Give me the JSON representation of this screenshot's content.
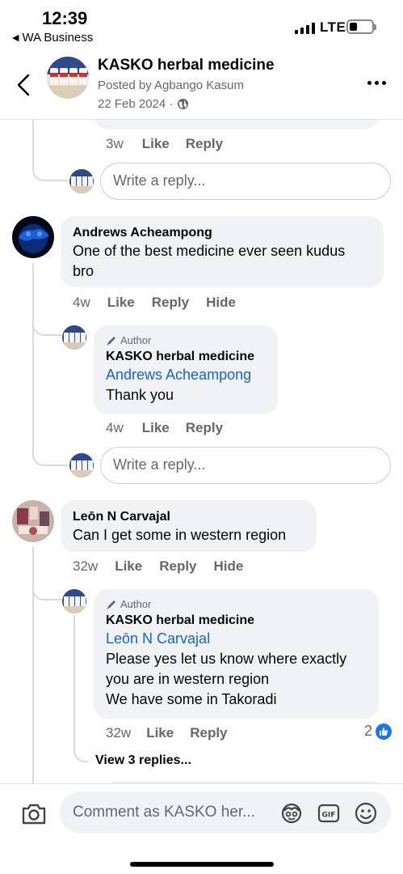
{
  "status": {
    "time": "12:39",
    "back_app": "WA Business",
    "network": "LTE"
  },
  "header": {
    "title": "KASKO herbal medicine",
    "posted_by": "Posted by Agbango Kasum",
    "date": "22 Feb 2024 ·"
  },
  "thread0": {
    "time": "3w",
    "like": "Like",
    "reply": "Reply",
    "reply_placeholder": "Write a reply..."
  },
  "comment1": {
    "name": "Andrews Acheampong",
    "text_line1": "One of the best medicine ever seen kudus",
    "text_line2": "bro",
    "time": "4w",
    "like": "Like",
    "reply": "Reply",
    "hide": "Hide",
    "author_reply": {
      "tag": "Author",
      "name": "KASKO herbal medicine",
      "mention": "Andrews Acheampong",
      "text": "Thank you",
      "time": "4w",
      "like": "Like",
      "reply": "Reply"
    },
    "reply_placeholder": "Write a reply..."
  },
  "comment2": {
    "name": "Leōn N Carvajal",
    "text": "Can I get some in western region",
    "time": "32w",
    "like": "Like",
    "reply": "Reply",
    "hide": "Hide",
    "author_reply": {
      "tag": "Author",
      "name": "KASKO herbal medicine",
      "mention": "Leōn N Carvajal",
      "line1": "Please yes let us know where exactly",
      "line2": "you are in western region",
      "line3": "We have some in Takoradi",
      "time": "32w",
      "like": "Like",
      "reply": "Reply",
      "reaction_count": "2"
    },
    "view_replies": "View 3 replies..."
  },
  "composer": {
    "placeholder": "Comment as KASKO her..."
  },
  "colors": {
    "link": "#1763cf",
    "bubble": "#f0f2f5",
    "muted": "#65676b",
    "like_blue": "#1877f2"
  }
}
